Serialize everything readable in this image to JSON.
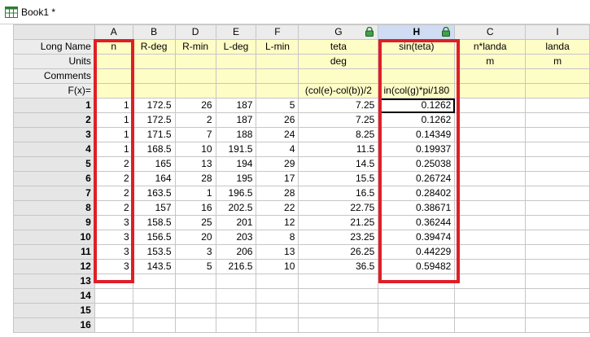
{
  "window": {
    "title": "Book1 *",
    "icon": "workbook-icon"
  },
  "sheet": {
    "columns": [
      {
        "letter": "A",
        "long_name": "n",
        "units": "",
        "comments": "",
        "formula": ""
      },
      {
        "letter": "B",
        "long_name": "R-deg",
        "units": "",
        "comments": "",
        "formula": ""
      },
      {
        "letter": "D",
        "long_name": "R-min",
        "units": "",
        "comments": "",
        "formula": ""
      },
      {
        "letter": "E",
        "long_name": "L-deg",
        "units": "",
        "comments": "",
        "formula": ""
      },
      {
        "letter": "F",
        "long_name": "L-min",
        "units": "",
        "comments": "",
        "formula": ""
      },
      {
        "letter": "G",
        "long_name": "teta",
        "units": "deg",
        "comments": "",
        "formula": "(col(e)-col(b))/2",
        "lock_icon": "lock-icon"
      },
      {
        "letter": "H",
        "long_name": "sin(teta)",
        "units": "",
        "comments": "",
        "formula": "in(col(g)*pi/180",
        "lock_icon": "lock-icon",
        "selected": true
      },
      {
        "letter": "C",
        "long_name": "n*landa",
        "units": "m",
        "comments": "",
        "formula": ""
      },
      {
        "letter": "I",
        "long_name": "landa",
        "units": "m",
        "comments": "",
        "formula": ""
      }
    ],
    "row_labels": {
      "long_name": "Long Name",
      "units": "Units",
      "comments": "Comments",
      "formula": "F(x)="
    },
    "rows": [
      {
        "num": "1",
        "cells": [
          "1",
          "172.5",
          "26",
          "187",
          "5",
          "7.25",
          "0.1262",
          "",
          ""
        ]
      },
      {
        "num": "2",
        "cells": [
          "1",
          "172.5",
          "2",
          "187",
          "26",
          "7.25",
          "0.1262",
          "",
          ""
        ]
      },
      {
        "num": "3",
        "cells": [
          "1",
          "171.5",
          "7",
          "188",
          "24",
          "8.25",
          "0.14349",
          "",
          ""
        ]
      },
      {
        "num": "4",
        "cells": [
          "1",
          "168.5",
          "10",
          "191.5",
          "4",
          "11.5",
          "0.19937",
          "",
          ""
        ]
      },
      {
        "num": "5",
        "cells": [
          "2",
          "165",
          "13",
          "194",
          "29",
          "14.5",
          "0.25038",
          "",
          ""
        ]
      },
      {
        "num": "6",
        "cells": [
          "2",
          "164",
          "28",
          "195",
          "17",
          "15.5",
          "0.26724",
          "",
          ""
        ]
      },
      {
        "num": "7",
        "cells": [
          "2",
          "163.5",
          "1",
          "196.5",
          "28",
          "16.5",
          "0.28402",
          "",
          ""
        ]
      },
      {
        "num": "8",
        "cells": [
          "2",
          "157",
          "16",
          "202.5",
          "22",
          "22.75",
          "0.38671",
          "",
          ""
        ]
      },
      {
        "num": "9",
        "cells": [
          "3",
          "158.5",
          "25",
          "201",
          "12",
          "21.25",
          "0.36244",
          "",
          ""
        ]
      },
      {
        "num": "10",
        "cells": [
          "3",
          "156.5",
          "20",
          "203",
          "8",
          "23.25",
          "0.39474",
          "",
          ""
        ]
      },
      {
        "num": "11",
        "cells": [
          "3",
          "153.5",
          "3",
          "206",
          "13",
          "26.25",
          "0.44229",
          "",
          ""
        ]
      },
      {
        "num": "12",
        "cells": [
          "3",
          "143.5",
          "5",
          "216.5",
          "10",
          "36.5",
          "0.59482",
          "",
          ""
        ]
      },
      {
        "num": "13",
        "cells": [
          "",
          "",
          "",
          "",
          "",
          "",
          "",
          "",
          ""
        ]
      },
      {
        "num": "14",
        "cells": [
          "",
          "",
          "",
          "",
          "",
          "",
          "",
          "",
          ""
        ]
      },
      {
        "num": "15",
        "cells": [
          "",
          "",
          "",
          "",
          "",
          "",
          "",
          "",
          ""
        ]
      },
      {
        "num": "16",
        "cells": [
          "",
          "",
          "",
          "",
          "",
          "",
          "",
          "",
          ""
        ]
      }
    ],
    "active_cell": {
      "row": 1,
      "col": "H"
    },
    "highlight_color": "#e01e26",
    "meta_bg": "#fffdc6"
  }
}
